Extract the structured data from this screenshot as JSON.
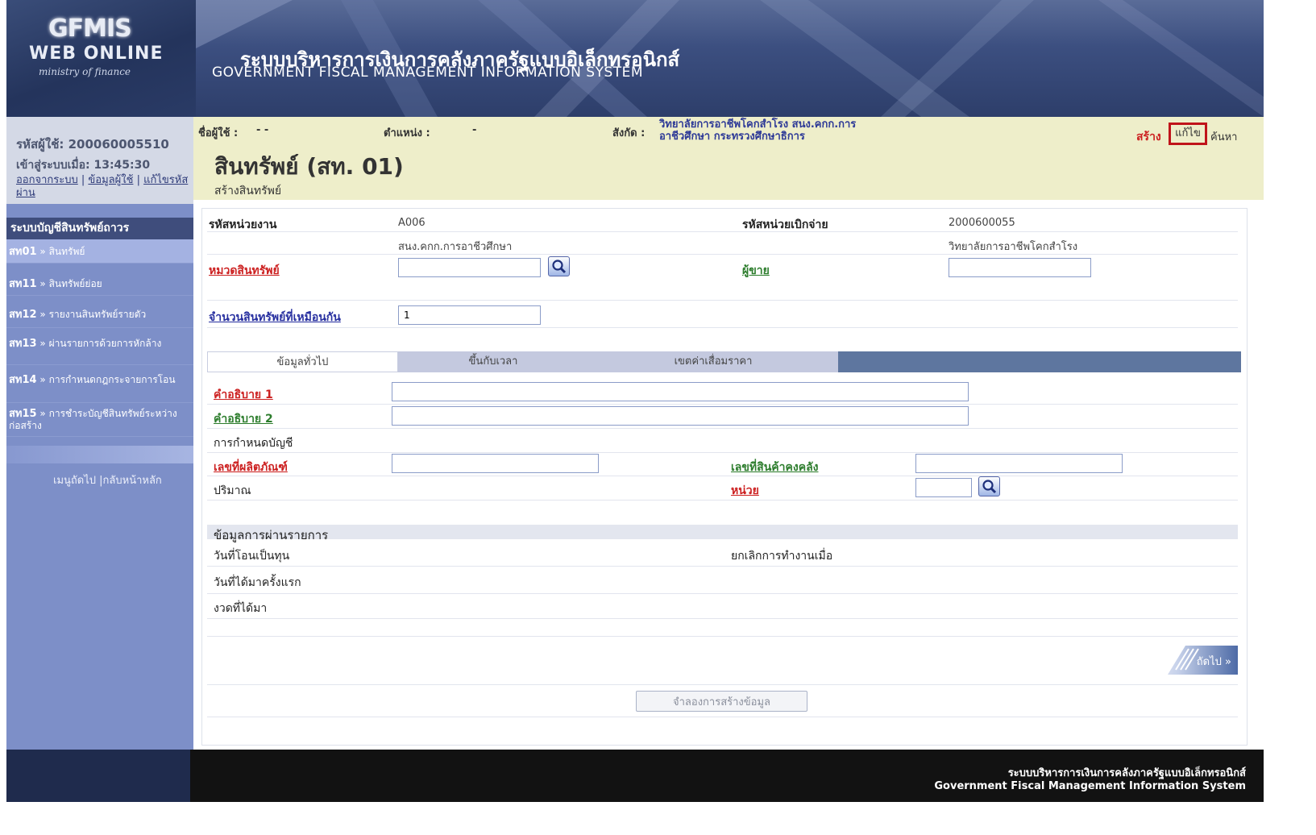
{
  "header": {
    "logo_line1": "GFMIS",
    "logo_line2": "WEB ONLINE",
    "logo_line3": "ministry of finance",
    "system_title_th": "ระบบบริหารการเงินการคลังภาครัฐแบบอิเล็กทรอนิกส์",
    "system_title_en": "GOVERNMENT FISCAL MANAGEMENT INFORMATION SYSTEM"
  },
  "user_panel": {
    "user_code": "รหัสผู้ใช้: 200060005510",
    "login_time": "เข้าสู่ระบบเมื่อ: 13:45:30",
    "logout_link": "ออกจากระบบ",
    "user_info_link": "ข้อมูลผู้ใช้",
    "change_password_link": "แก้ไขรหัสผ่าน"
  },
  "userbar": {
    "username_label": "ชื่อผู้ใช้ :",
    "username_value": "- -",
    "position_label": "ตำแหน่ง :",
    "position_value": "-",
    "org_label": "สังกัด :",
    "org_value_line1": "วิทยาลัยการอาชีพโคกสำโรง สนง.คกก.การ",
    "org_value_line2": "อาชีวศึกษา กระทรวงศึกษาธิการ",
    "action_create": "สร้าง",
    "action_edit": "แก้ไข",
    "action_search": "ค้นหา",
    "page_title": "สินทรัพย์ (สท. 01)",
    "page_subtitle": "สร้างสินทรัพย์"
  },
  "sidebar": {
    "heading": "ระบบบัญชีสินทรัพย์ถาวร",
    "items": [
      {
        "code": "สท01",
        "label": "สินทรัพย์"
      },
      {
        "code": "สท11",
        "label": "สินทรัพย์ย่อย"
      },
      {
        "code": "สท12",
        "label": "รายงานสินทรัพย์รายตัว"
      },
      {
        "code": "สท13",
        "label": "ผ่านรายการด้วยการหักล้าง"
      },
      {
        "code": "สท14",
        "label": "การกำหนดกฎกระจายการโอน"
      },
      {
        "code": "สท15",
        "label": "การชำระบัญชีสินทรัพย์ระหว่างก่อสร้าง"
      }
    ],
    "nav_next": "เมนูถัดไป",
    "nav_home": "กลับหน้าหลัก"
  },
  "form": {
    "agency_code_label": "รหัสหน่วยงาน",
    "agency_code_value": "A006",
    "agency_name": "สนง.คกก.การอาชีวศึกษา",
    "disbursement_code_label": "รหัสหน่วยเบิกจ่าย",
    "disbursement_code_value": "2000600055",
    "disbursement_name": "วิทยาลัยการอาชีพโคกสำโรง",
    "asset_category_label": "หมวดสินทรัพย์",
    "asset_category_value": "",
    "vendor_label": "ผู้ขาย",
    "vendor_value": "",
    "same_asset_count_label": "จำนวนสินทรัพย์ที่เหมือนกัน",
    "same_asset_count_value": "1"
  },
  "tabs": {
    "general": "ข้อมูลทั่วไป",
    "time_dependent": "ขึ้นกับเวลา",
    "depreciation": "เขตค่าเสื่อมราคา"
  },
  "general_tab": {
    "desc1_label": "คำอธิบาย 1",
    "desc1_value": "",
    "desc2_label": "คำอธิบาย 2",
    "desc2_value": "",
    "account_assignment_label": "การกำหนดบัญชี",
    "product_no_label": "เลขที่ผลิตภัณฑ์",
    "product_no_value": "",
    "inventory_no_label": "เลขที่สินค้าคงคลัง",
    "inventory_no_value": "",
    "quantity_label": "ปริมาณ",
    "unit_label": "หน่วย",
    "unit_value": "",
    "posting_info_label": "ข้อมูลการผ่านรายการ",
    "capitalization_date_label": "วันที่โอนเป็นทุน",
    "deactivation_label": "ยกเลิกการทำงานเมื่อ",
    "first_acquisition_label": "วันที่ได้มาครั้งแรก",
    "acquisition_period_label": "งวดที่ได้มา"
  },
  "buttons": {
    "next": "ถัดไป »",
    "simulate": "จำลองการสร้างข้อมูล"
  },
  "footer": {
    "title_th": "ระบบบริหารการเงินการคลังภาครัฐแบบอิเล็กทรอนิกส์",
    "title_en": "Government Fiscal Management Information System"
  },
  "colors": {
    "sidebar_bg": "#7d8fc8",
    "header_bg": "#2d3e6a",
    "userbar_bg": "#eeeeca",
    "required_red": "#cc2020",
    "tab_bar": "#5e769f"
  }
}
